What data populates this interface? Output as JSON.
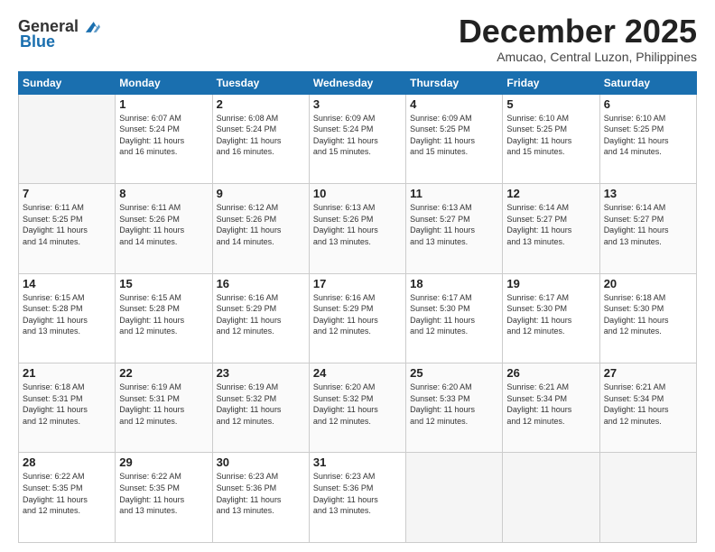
{
  "header": {
    "logo_general": "General",
    "logo_blue": "Blue",
    "title": "December 2025",
    "subtitle": "Amucao, Central Luzon, Philippines"
  },
  "days_of_week": [
    "Sunday",
    "Monday",
    "Tuesday",
    "Wednesday",
    "Thursday",
    "Friday",
    "Saturday"
  ],
  "weeks": [
    [
      {
        "day": "",
        "info": ""
      },
      {
        "day": "1",
        "info": "Sunrise: 6:07 AM\nSunset: 5:24 PM\nDaylight: 11 hours\nand 16 minutes."
      },
      {
        "day": "2",
        "info": "Sunrise: 6:08 AM\nSunset: 5:24 PM\nDaylight: 11 hours\nand 16 minutes."
      },
      {
        "day": "3",
        "info": "Sunrise: 6:09 AM\nSunset: 5:24 PM\nDaylight: 11 hours\nand 15 minutes."
      },
      {
        "day": "4",
        "info": "Sunrise: 6:09 AM\nSunset: 5:25 PM\nDaylight: 11 hours\nand 15 minutes."
      },
      {
        "day": "5",
        "info": "Sunrise: 6:10 AM\nSunset: 5:25 PM\nDaylight: 11 hours\nand 15 minutes."
      },
      {
        "day": "6",
        "info": "Sunrise: 6:10 AM\nSunset: 5:25 PM\nDaylight: 11 hours\nand 14 minutes."
      }
    ],
    [
      {
        "day": "7",
        "info": "Sunrise: 6:11 AM\nSunset: 5:25 PM\nDaylight: 11 hours\nand 14 minutes."
      },
      {
        "day": "8",
        "info": "Sunrise: 6:11 AM\nSunset: 5:26 PM\nDaylight: 11 hours\nand 14 minutes."
      },
      {
        "day": "9",
        "info": "Sunrise: 6:12 AM\nSunset: 5:26 PM\nDaylight: 11 hours\nand 14 minutes."
      },
      {
        "day": "10",
        "info": "Sunrise: 6:13 AM\nSunset: 5:26 PM\nDaylight: 11 hours\nand 13 minutes."
      },
      {
        "day": "11",
        "info": "Sunrise: 6:13 AM\nSunset: 5:27 PM\nDaylight: 11 hours\nand 13 minutes."
      },
      {
        "day": "12",
        "info": "Sunrise: 6:14 AM\nSunset: 5:27 PM\nDaylight: 11 hours\nand 13 minutes."
      },
      {
        "day": "13",
        "info": "Sunrise: 6:14 AM\nSunset: 5:27 PM\nDaylight: 11 hours\nand 13 minutes."
      }
    ],
    [
      {
        "day": "14",
        "info": "Sunrise: 6:15 AM\nSunset: 5:28 PM\nDaylight: 11 hours\nand 13 minutes."
      },
      {
        "day": "15",
        "info": "Sunrise: 6:15 AM\nSunset: 5:28 PM\nDaylight: 11 hours\nand 12 minutes."
      },
      {
        "day": "16",
        "info": "Sunrise: 6:16 AM\nSunset: 5:29 PM\nDaylight: 11 hours\nand 12 minutes."
      },
      {
        "day": "17",
        "info": "Sunrise: 6:16 AM\nSunset: 5:29 PM\nDaylight: 11 hours\nand 12 minutes."
      },
      {
        "day": "18",
        "info": "Sunrise: 6:17 AM\nSunset: 5:30 PM\nDaylight: 11 hours\nand 12 minutes."
      },
      {
        "day": "19",
        "info": "Sunrise: 6:17 AM\nSunset: 5:30 PM\nDaylight: 11 hours\nand 12 minutes."
      },
      {
        "day": "20",
        "info": "Sunrise: 6:18 AM\nSunset: 5:30 PM\nDaylight: 11 hours\nand 12 minutes."
      }
    ],
    [
      {
        "day": "21",
        "info": "Sunrise: 6:18 AM\nSunset: 5:31 PM\nDaylight: 11 hours\nand 12 minutes."
      },
      {
        "day": "22",
        "info": "Sunrise: 6:19 AM\nSunset: 5:31 PM\nDaylight: 11 hours\nand 12 minutes."
      },
      {
        "day": "23",
        "info": "Sunrise: 6:19 AM\nSunset: 5:32 PM\nDaylight: 11 hours\nand 12 minutes."
      },
      {
        "day": "24",
        "info": "Sunrise: 6:20 AM\nSunset: 5:32 PM\nDaylight: 11 hours\nand 12 minutes."
      },
      {
        "day": "25",
        "info": "Sunrise: 6:20 AM\nSunset: 5:33 PM\nDaylight: 11 hours\nand 12 minutes."
      },
      {
        "day": "26",
        "info": "Sunrise: 6:21 AM\nSunset: 5:34 PM\nDaylight: 11 hours\nand 12 minutes."
      },
      {
        "day": "27",
        "info": "Sunrise: 6:21 AM\nSunset: 5:34 PM\nDaylight: 11 hours\nand 12 minutes."
      }
    ],
    [
      {
        "day": "28",
        "info": "Sunrise: 6:22 AM\nSunset: 5:35 PM\nDaylight: 11 hours\nand 12 minutes."
      },
      {
        "day": "29",
        "info": "Sunrise: 6:22 AM\nSunset: 5:35 PM\nDaylight: 11 hours\nand 13 minutes."
      },
      {
        "day": "30",
        "info": "Sunrise: 6:23 AM\nSunset: 5:36 PM\nDaylight: 11 hours\nand 13 minutes."
      },
      {
        "day": "31",
        "info": "Sunrise: 6:23 AM\nSunset: 5:36 PM\nDaylight: 11 hours\nand 13 minutes."
      },
      {
        "day": "",
        "info": ""
      },
      {
        "day": "",
        "info": ""
      },
      {
        "day": "",
        "info": ""
      }
    ]
  ]
}
